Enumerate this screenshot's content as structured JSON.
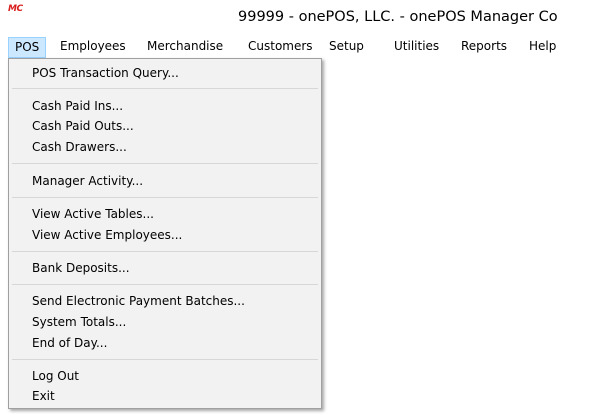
{
  "window": {
    "icon_text": "MC",
    "title": "99999 - onePOS, LLC. - onePOS Manager Co"
  },
  "menubar": {
    "items": [
      {
        "label": "POS"
      },
      {
        "label": "Employees"
      },
      {
        "label": "Merchandise"
      },
      {
        "label": "Customers"
      },
      {
        "label": "Setup"
      },
      {
        "label": "Utilities"
      },
      {
        "label": "Reports"
      },
      {
        "label": "Help"
      }
    ]
  },
  "pos_menu": {
    "items": [
      {
        "label": "POS Transaction Query..."
      },
      {
        "label": "Cash Paid Ins..."
      },
      {
        "label": "Cash Paid Outs..."
      },
      {
        "label": "Cash Drawers..."
      },
      {
        "label": "Manager Activity..."
      },
      {
        "label": "View Active Tables..."
      },
      {
        "label": "View Active Employees..."
      },
      {
        "label": "Bank Deposits..."
      },
      {
        "label": "Send Electronic Payment Batches..."
      },
      {
        "label": "System Totals..."
      },
      {
        "label": "End of Day..."
      },
      {
        "label": "Log Out"
      },
      {
        "label": "Exit"
      }
    ]
  },
  "colors": {
    "menu_highlight": "#cce8ff",
    "menu_highlight_border": "#99d1ff",
    "dropdown_bg": "#f2f2f2",
    "icon_red": "#d9201f"
  }
}
